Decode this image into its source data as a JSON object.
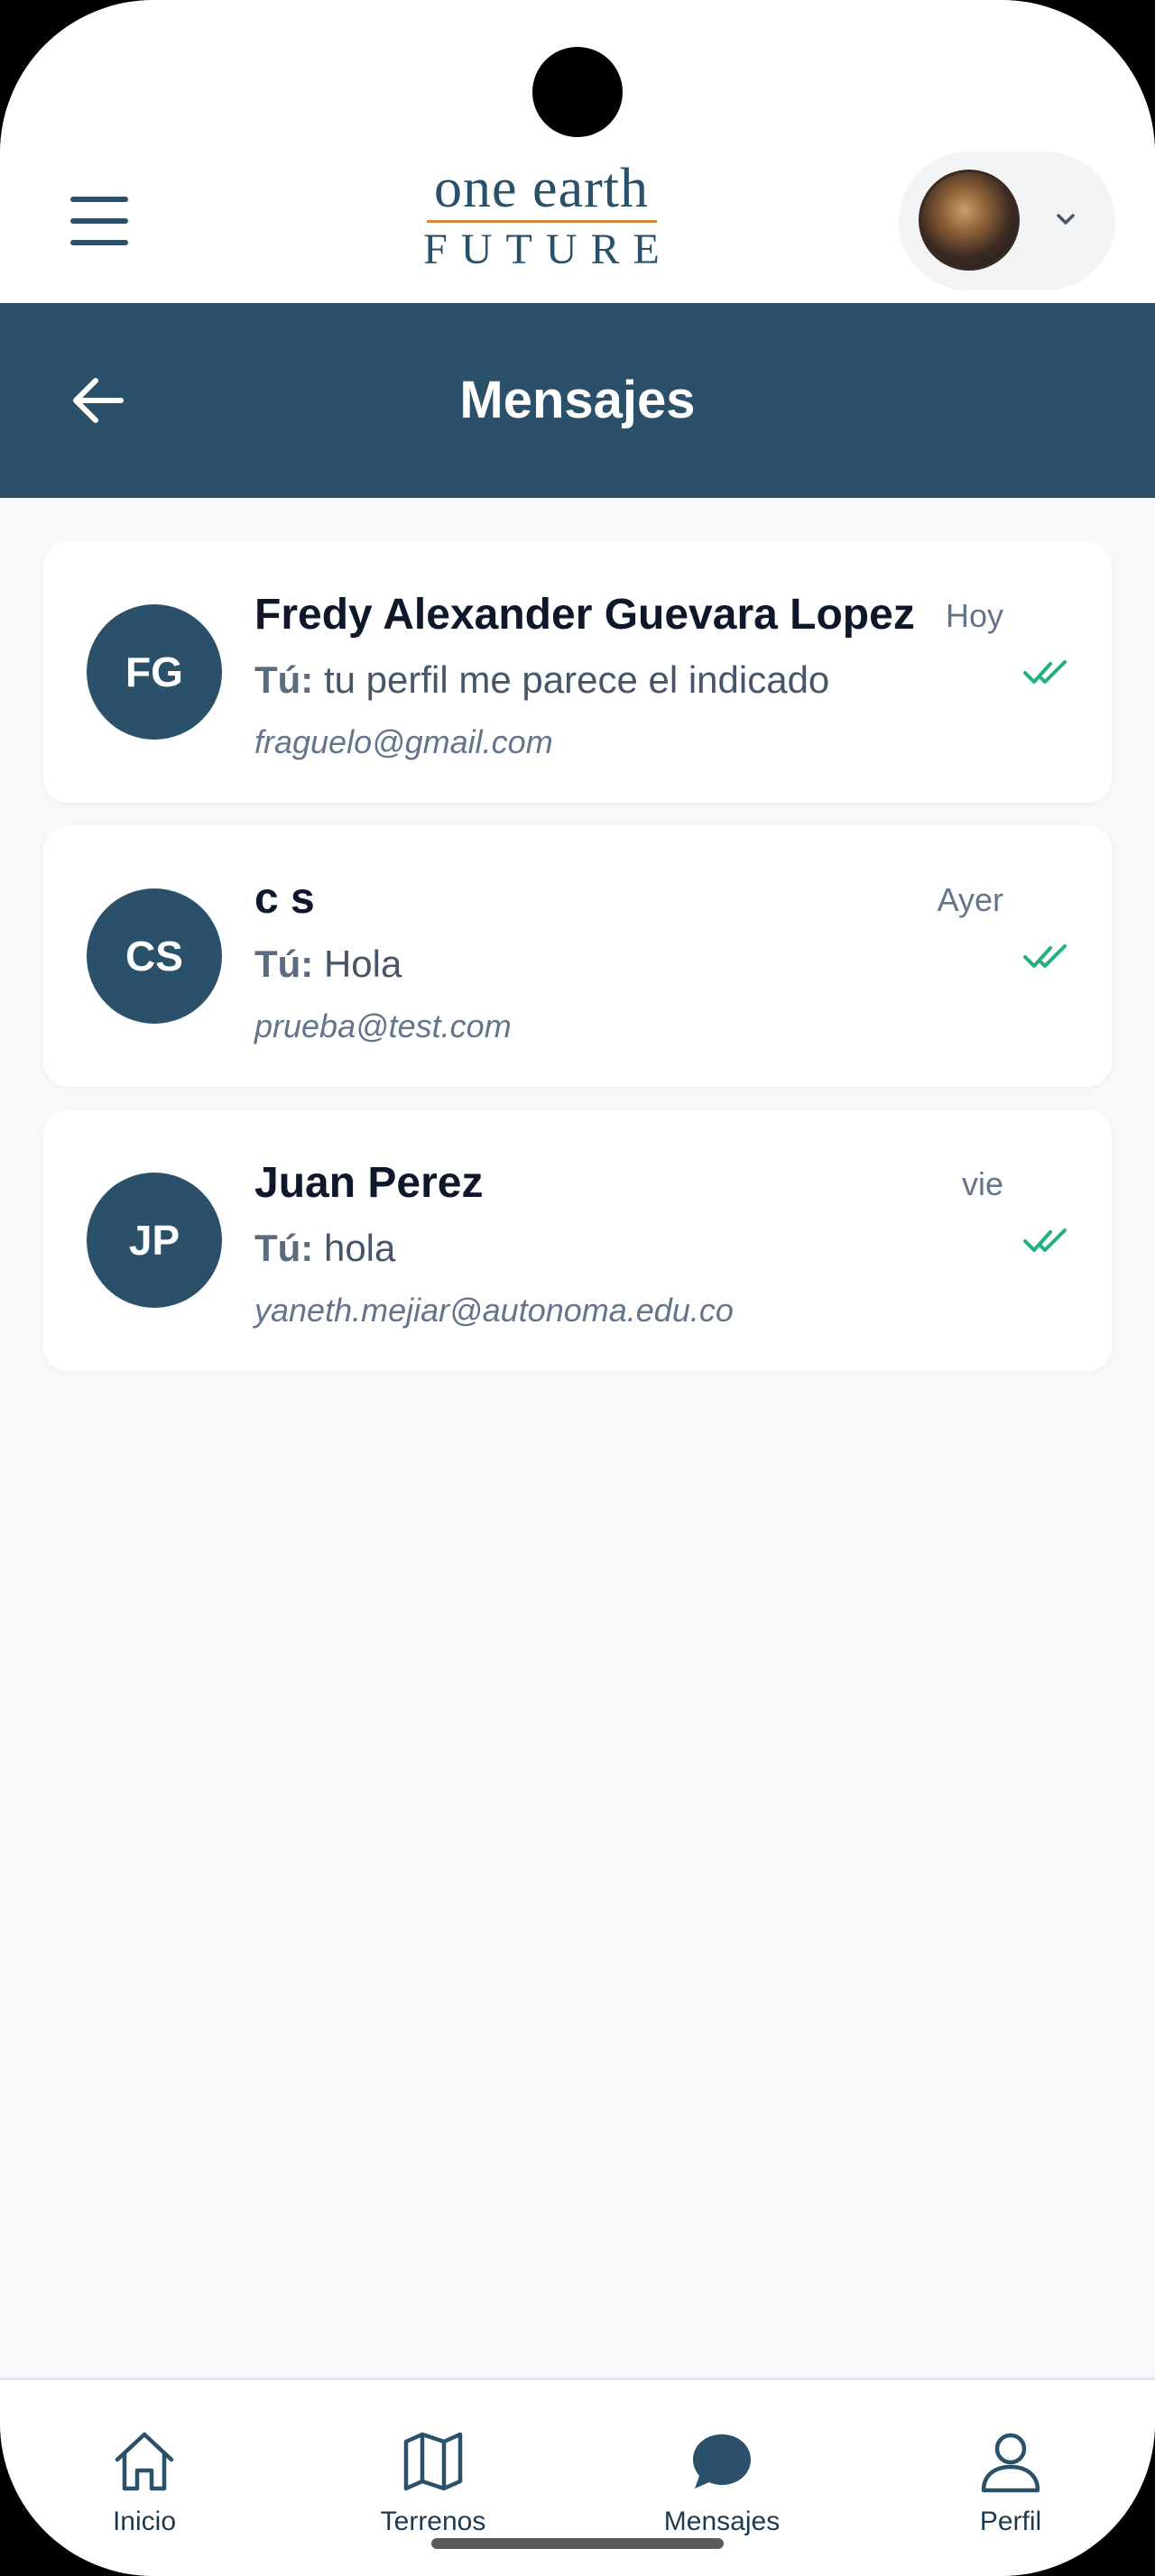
{
  "app": {
    "logo": {
      "line1": "one earth",
      "line2": "FUTURE"
    }
  },
  "header": {
    "title": "Mensajes"
  },
  "conversations": [
    {
      "initials": "FG",
      "name": "Fredy Alexander Guevara Lopez",
      "preview_prefix": "Tú:",
      "preview": " tu perfil me parece el indicado",
      "email": "fraguelo@gmail.com",
      "time": "Hoy",
      "status": "read"
    },
    {
      "initials": "CS",
      "name": "c s",
      "preview_prefix": "Tú:",
      "preview": " Hola",
      "email": "prueba@test.com",
      "time": "Ayer",
      "status": "read"
    },
    {
      "initials": "JP",
      "name": "Juan Perez",
      "preview_prefix": "Tú:",
      "preview": " hola",
      "email": "yaneth.mejiar@autonoma.edu.co",
      "time": "vie",
      "status": "read"
    }
  ],
  "bottom_nav": [
    {
      "label": "Inicio",
      "icon": "home-icon"
    },
    {
      "label": "Terrenos",
      "icon": "map-icon"
    },
    {
      "label": "Mensajes",
      "icon": "chat-bubble-icon",
      "active": true
    },
    {
      "label": "Perfil",
      "icon": "user-icon"
    }
  ],
  "colors": {
    "primary": "#2b5069",
    "accent_rule": "#d58a3b",
    "read_check": "#22b07d",
    "background": "#f7f8fa"
  }
}
